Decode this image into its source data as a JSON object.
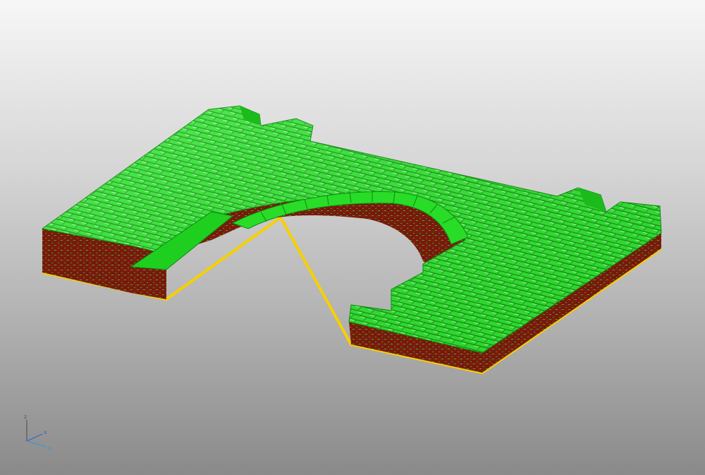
{
  "viewport": {
    "background_top": "#f7f7f7",
    "background_bottom": "#8a8a8a"
  },
  "model": {
    "surface_color": "#2ee82e",
    "highlight_color": "#8cff8c",
    "shadow_color": "#14a514",
    "side_color": "#7a1a0c",
    "side_speckle_color": "#3f9a2a",
    "edge_color": "#f5d000"
  },
  "triad": {
    "x_label": "x",
    "y_label": "y",
    "z_label": "z",
    "x_color": "#3a5fd0",
    "y_color": "#3a9ad0",
    "z_color": "#555555",
    "icon": "axis-triad-icon"
  }
}
